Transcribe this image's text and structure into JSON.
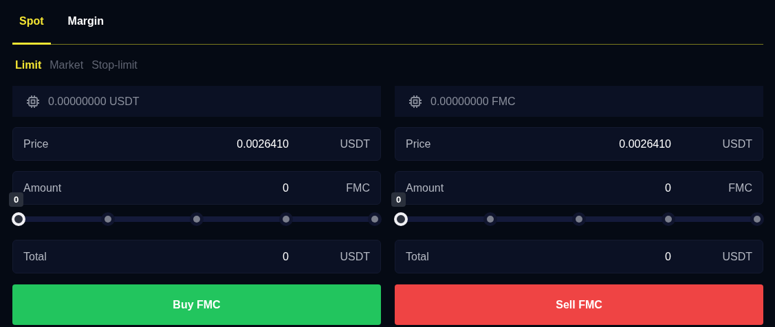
{
  "tabs": [
    {
      "label": "Spot",
      "selected": true
    },
    {
      "label": "Margin",
      "selected": false
    }
  ],
  "order_types": [
    {
      "label": "Limit",
      "selected": true
    },
    {
      "label": "Market",
      "selected": false
    },
    {
      "label": "Stop-limit",
      "selected": false
    }
  ],
  "panels": [
    {
      "balance": "0.00000000 USDT",
      "fields": [
        {
          "label": "Price",
          "value": "0.0026410",
          "unit": "USDT"
        },
        {
          "label": "Amount",
          "value": "0",
          "unit": "FMC"
        }
      ],
      "slider": {
        "level": 0,
        "tooltip": "0"
      },
      "total": {
        "label": "Total",
        "value": "0",
        "unit": "USDT"
      },
      "button": {
        "label": "Buy FMC",
        "kind": "buy"
      }
    },
    {
      "balance": "0.00000000 FMC",
      "fields": [
        {
          "label": "Price",
          "value": "0.0026410",
          "unit": "USDT"
        },
        {
          "label": "Amount",
          "value": "0",
          "unit": "FMC"
        }
      ],
      "slider": {
        "level": 0,
        "tooltip": "0"
      },
      "total": {
        "label": "Total",
        "value": "0",
        "unit": "USDT"
      },
      "button": {
        "label": "Sell FMC",
        "kind": "sell"
      }
    }
  ]
}
